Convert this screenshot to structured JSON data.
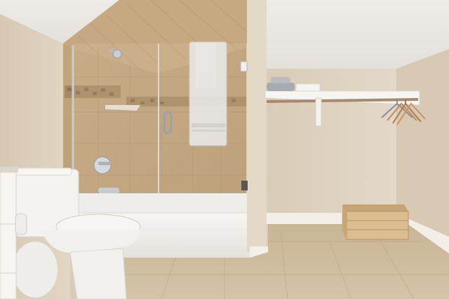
{
  "scene": {
    "kind": "photo",
    "palette": {
      "wall": "#ddd1bf",
      "wall_shadow": "#c9bba5",
      "ceiling": "#ece9e4",
      "tile": "#c8ad87",
      "tile_dark": "#a88b63",
      "floor": "#cdbb9d",
      "porcelain": "#f4f3f0",
      "chrome": "#b9bdc2",
      "trim": "#f2efe9",
      "wood": "#d8b88a"
    },
    "icons": [
      "toilet-icon",
      "shower-head-icon",
      "towel-icon",
      "hanger-icon",
      "crate-icon"
    ]
  }
}
